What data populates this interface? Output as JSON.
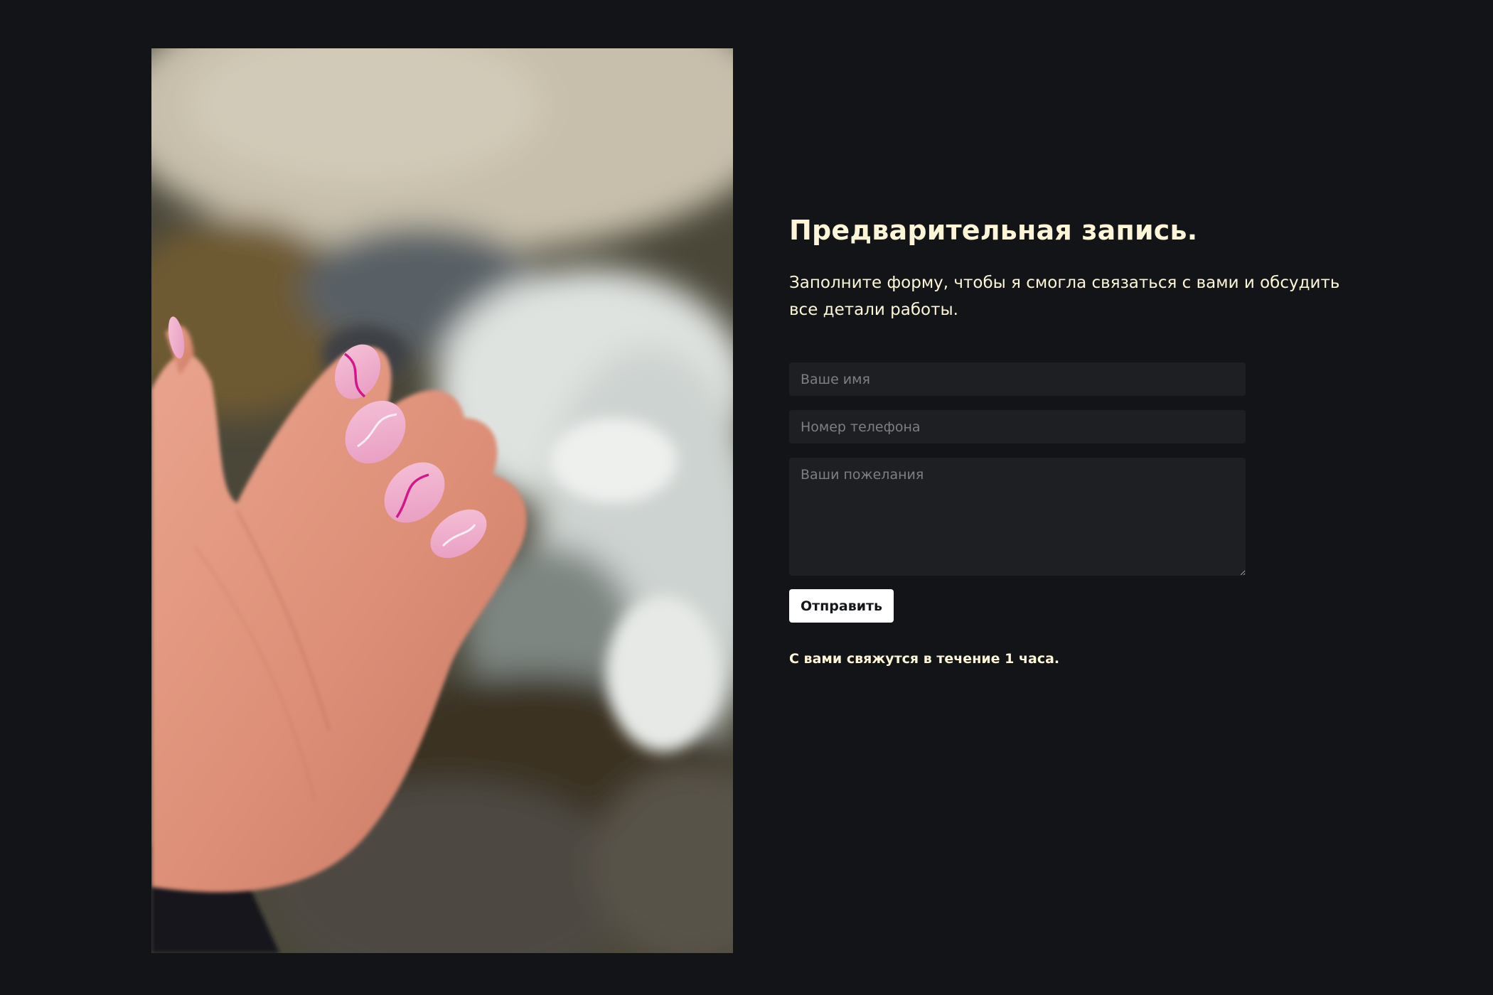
{
  "photo": {
    "subject": "hand with pink nail art over a mountain stream"
  },
  "booking": {
    "title": "Предварительная запись.",
    "subtitle": "Заполните форму, чтобы я смогла связаться с вами и обсудить все детали работы."
  },
  "form": {
    "name_placeholder": "Ваше имя",
    "name_value": "",
    "phone_placeholder": "Номер телефона",
    "phone_value": "",
    "wishes_placeholder": "Ваши пожелания",
    "wishes_value": "",
    "submit_label": "Отправить"
  },
  "note": "С вами свяжутся в течение 1 часа.",
  "colors": {
    "page_background": "#131417",
    "heading_text": "#fdf5d8",
    "field_background": "#1e1f22",
    "button_background": "#ffffff",
    "button_text": "#16171a"
  }
}
